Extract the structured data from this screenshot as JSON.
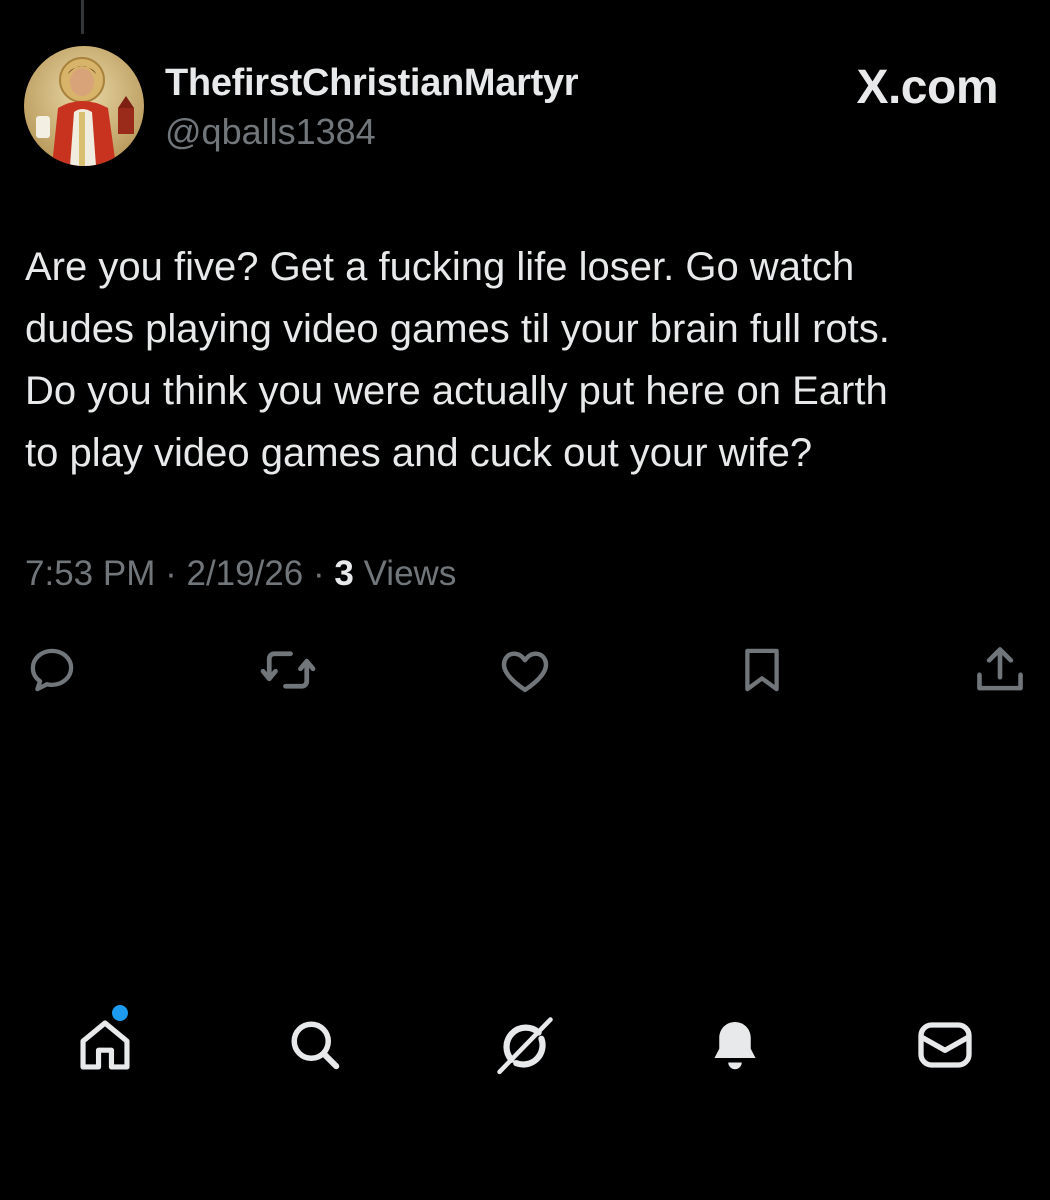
{
  "author": {
    "display_name": "ThefirstChristianMartyr",
    "handle": "@qballs1384"
  },
  "watermark": "X.com",
  "tweet": {
    "lines": [
      "Are you five? Get a fucking life loser.  Go watch",
      "dudes playing video games til your brain full rots.",
      "Do you think you were actually put here on Earth",
      "to play video games and cuck out your wife?"
    ],
    "time": "7:53 PM",
    "separator": "·",
    "date": "2/19/26",
    "views_count": "3",
    "views_label": "Views"
  },
  "actions": {
    "reply_icon": "reply-icon",
    "repost_icon": "repost-icon",
    "like_icon": "heart-icon",
    "bookmark_icon": "bookmark-icon",
    "share_icon": "share-icon"
  },
  "bottom_nav": {
    "items": [
      "home-icon",
      "search-icon",
      "grok-icon",
      "notifications-bell-icon",
      "messages-envelope-icon"
    ],
    "home_has_unread_dot": true
  },
  "colors": {
    "background": "#000000",
    "primary_text": "#e7e9ea",
    "secondary_text": "#71767b",
    "icon_gray": "#71767b",
    "accent_blue": "#1d9bf0"
  }
}
